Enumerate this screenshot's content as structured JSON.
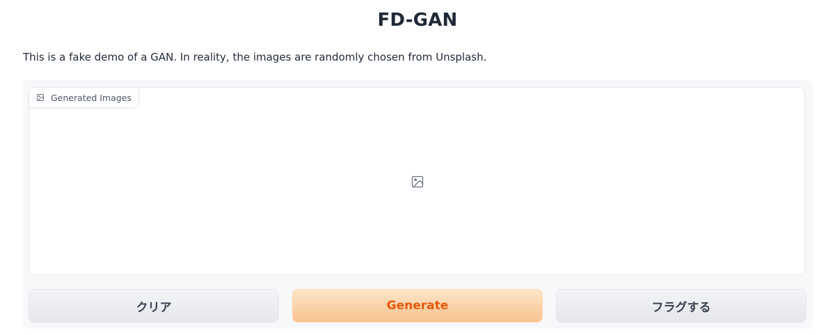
{
  "app": {
    "title": "FD-GAN",
    "description": "This is a fake demo of a GAN. In reality, the images are randomly chosen from Unsplash."
  },
  "gallery": {
    "label": "Generated Images",
    "label_icon": "image-icon",
    "placeholder_icon": "image-icon"
  },
  "buttons": {
    "clear_label": "クリア",
    "generate_label": "Generate",
    "flag_label": "フラグする"
  },
  "colors": {
    "primary_text": "#ea580c",
    "primary_bg": "#f9c28f",
    "secondary_bg": "#e5e7eb"
  }
}
